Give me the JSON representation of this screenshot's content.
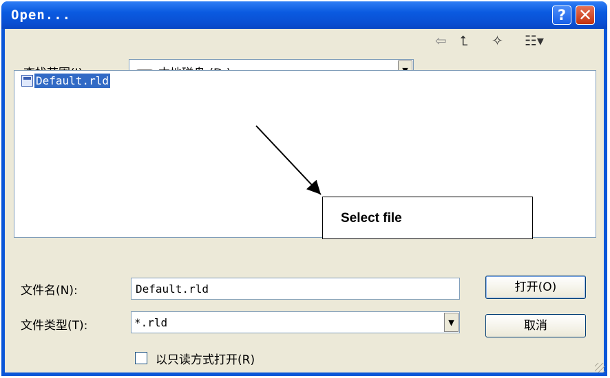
{
  "window": {
    "title": "Open..."
  },
  "title_buttons": {
    "help": "?",
    "close": "✕"
  },
  "lookin": {
    "label": "查找范围(I):",
    "value": "本地磁盘  (D:)"
  },
  "toolbar": {
    "back": "⇦",
    "up": "⮤",
    "new_folder": "✧",
    "view": "☷▾"
  },
  "files": [
    {
      "name": "Default.rld"
    }
  ],
  "annotation": {
    "text": "Select file"
  },
  "filename_field": {
    "label": "文件名(N):",
    "value": "Default.rld"
  },
  "filetype_field": {
    "label": "文件类型(T):",
    "value": "*.rld"
  },
  "readonly_checkbox": {
    "label": "以只读方式打开(R)"
  },
  "buttons": {
    "open": "打开(O)",
    "cancel": "取消"
  }
}
